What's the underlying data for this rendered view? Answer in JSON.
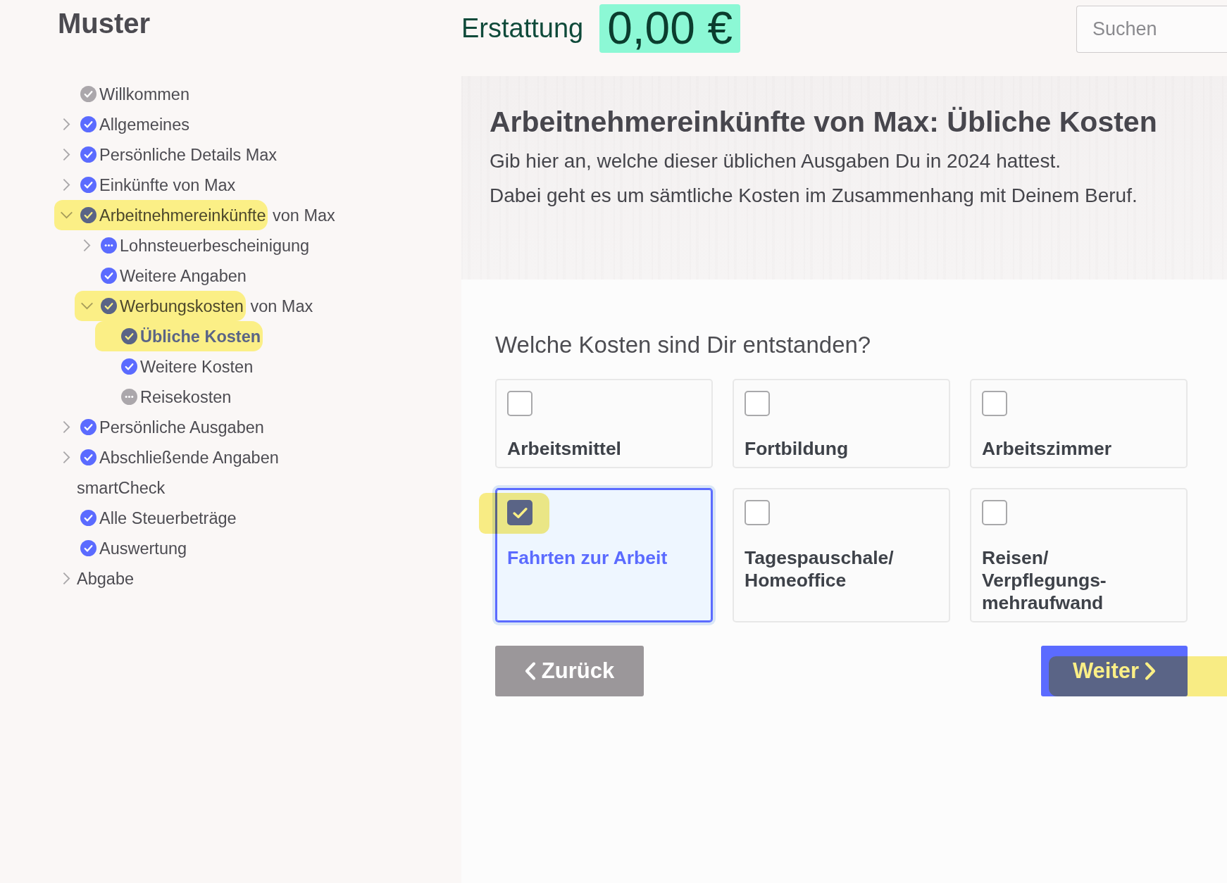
{
  "brand": {
    "name": "Muster"
  },
  "header": {
    "refund_label": "Erstattung",
    "refund_amount": "0,00 €",
    "search": {
      "placeholder": "Suchen"
    }
  },
  "sidebar": {
    "items": [
      {
        "label": "Willkommen",
        "kind": "done",
        "muted": true,
        "has_children": false,
        "selected": false,
        "highlighted": false
      },
      {
        "label": "Allgemeines",
        "kind": "done",
        "muted": false,
        "has_children": true,
        "expanded": false,
        "selected": false,
        "highlighted": false
      },
      {
        "label": "Persönliche Details Max",
        "kind": "done",
        "muted": false,
        "has_children": true,
        "expanded": false,
        "selected": false,
        "highlighted": false
      },
      {
        "label": "Einkünfte von Max",
        "kind": "done",
        "muted": false,
        "has_children": true,
        "expanded": false,
        "selected": false,
        "highlighted": false
      },
      {
        "label": "Arbeitnehmereinkünfte",
        "suffix": "von Max",
        "kind": "done",
        "muted": false,
        "has_children": true,
        "expanded": true,
        "selected": false,
        "highlighted": true,
        "children": [
          {
            "label": "Lohnsteuerbescheinigung",
            "kind": "open",
            "muted": false,
            "has_children": true,
            "expanded": false,
            "selected": false,
            "highlighted": false
          },
          {
            "label": "Weitere Angaben",
            "kind": "done",
            "muted": false,
            "has_children": false,
            "selected": false,
            "highlighted": false
          },
          {
            "label": "Werbungskosten",
            "suffix": "von Max",
            "kind": "done",
            "muted": false,
            "has_children": true,
            "expanded": true,
            "selected": false,
            "highlighted": true,
            "children": [
              {
                "label": "Übliche Kosten",
                "kind": "done",
                "muted": false,
                "has_children": false,
                "selected": true,
                "highlighted": true
              },
              {
                "label": "Weitere Kosten",
                "kind": "done",
                "muted": false,
                "has_children": false,
                "selected": false,
                "highlighted": false
              },
              {
                "label": "Reisekosten",
                "kind": "open",
                "muted": true,
                "has_children": false,
                "selected": false,
                "highlighted": false
              }
            ]
          }
        ]
      },
      {
        "label": "Persönliche Ausgaben",
        "kind": "done",
        "muted": false,
        "has_children": true,
        "expanded": false,
        "selected": false,
        "highlighted": false
      },
      {
        "label": "Abschließende Angaben",
        "kind": "done",
        "muted": false,
        "has_children": true,
        "expanded": false,
        "selected": false,
        "highlighted": false
      },
      {
        "label": "smartCheck",
        "kind": "plain",
        "has_children": false,
        "selected": false,
        "highlighted": false
      },
      {
        "label": "Alle Steuerbeträge",
        "kind": "done",
        "muted": false,
        "has_children": false,
        "selected": false,
        "highlighted": false
      },
      {
        "label": "Auswertung",
        "kind": "done",
        "muted": false,
        "has_children": false,
        "selected": false,
        "highlighted": false
      },
      {
        "label": "Abgabe",
        "kind": "plain",
        "has_children": true,
        "expanded": false,
        "selected": false,
        "highlighted": false
      }
    ]
  },
  "page": {
    "title": "Arbeitnehmereinkünfte von Max: Übliche Kosten",
    "intro": [
      "Gib hier an, welche dieser üblichen Ausgaben Du in 2024 hattest.",
      "Dabei geht es um sämtliche Kosten im Zusammenhang mit Deinem Beruf."
    ]
  },
  "question": {
    "text": "Welche Kosten sind Dir entstanden?",
    "options": [
      {
        "label": "Arbeitsmittel",
        "checked": false,
        "highlighted": false
      },
      {
        "label": "Fortbildung",
        "checked": false,
        "highlighted": false
      },
      {
        "label": "Arbeitszimmer",
        "checked": false,
        "highlighted": false
      },
      {
        "label": "Fahrten zur Arbeit",
        "checked": true,
        "highlighted": true
      },
      {
        "label": "Tagespauschale/ Homeoffice",
        "checked": false,
        "highlighted": false
      },
      {
        "label": "Reisen/ Verpflegungs- mehraufwand",
        "checked": false,
        "highlighted": false
      }
    ]
  },
  "buttons": [
    {
      "kind": "back",
      "label": "Zurück",
      "highlighted": false
    },
    {
      "kind": "next",
      "label": "Weiter",
      "highlighted": true
    }
  ]
}
